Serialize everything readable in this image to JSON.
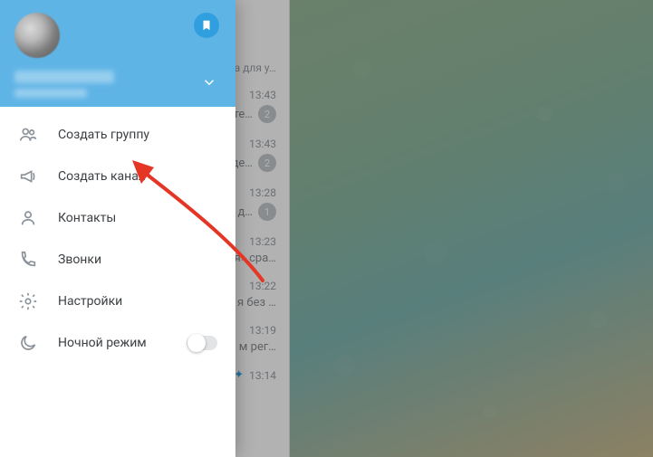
{
  "drawer": {
    "bookmark_tooltip": "Saved Messages",
    "menu": [
      {
        "key": "new-group",
        "label": "Создать группу"
      },
      {
        "key": "new-channel",
        "label": "Создать канал"
      },
      {
        "key": "contacts",
        "label": "Контакты"
      },
      {
        "key": "calls",
        "label": "Звонки"
      },
      {
        "key": "settings",
        "label": "Настройки"
      },
      {
        "key": "night-mode",
        "label": "Ночной режим"
      }
    ],
    "night_mode_on": false
  },
  "chat_list": [
    {
      "time": "",
      "snippet": "а для у…",
      "badge": ""
    },
    {
      "time": "13:43",
      "snippet": "те…",
      "badge": "2"
    },
    {
      "time": "13:43",
      "snippet": "де…",
      "badge": "2"
    },
    {
      "time": "13:28",
      "snippet": "а д…",
      "badge": "1"
    },
    {
      "time": "13:23",
      "snippet": "я» сра…",
      "badge": ""
    },
    {
      "time": "13:22",
      "snippet": "я без …",
      "badge": ""
    },
    {
      "time": "13:19",
      "snippet": "м рег…",
      "badge": ""
    },
    {
      "time": "13:14",
      "snippet": "",
      "badge": "",
      "verified": true
    }
  ]
}
